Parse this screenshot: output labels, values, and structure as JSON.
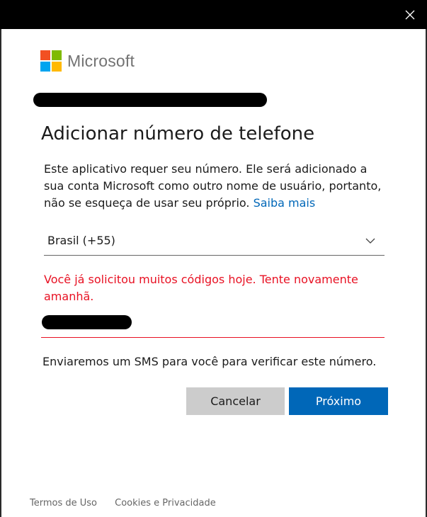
{
  "window": {
    "close_icon": "close-icon"
  },
  "brand": {
    "name": "Microsoft",
    "colors": {
      "red": "#f25022",
      "green": "#7fba00",
      "blue": "#00a4ef",
      "yellow": "#ffb900"
    }
  },
  "page": {
    "title": "Adicionar número de telefone",
    "description": "Este aplicativo requer seu número. Ele será adicionado a sua conta Microsoft como outro nome de usuário, portanto, não se esqueça de usar seu próprio.",
    "learn_more": "Saiba mais"
  },
  "country_select": {
    "selected": "Brasil (+55)",
    "icon": "chevron-down-icon"
  },
  "error": {
    "message": "Você já solicitou muitos códigos hoje. Tente novamente amanhã.",
    "color": "#e81123"
  },
  "sms_notice": "Enviaremos um SMS para você para verificar este número.",
  "buttons": {
    "cancel": "Cancelar",
    "next": "Próximo",
    "accent": "#0067b8"
  },
  "footer": {
    "terms": "Termos de Uso",
    "privacy": "Cookies e Privacidade"
  }
}
